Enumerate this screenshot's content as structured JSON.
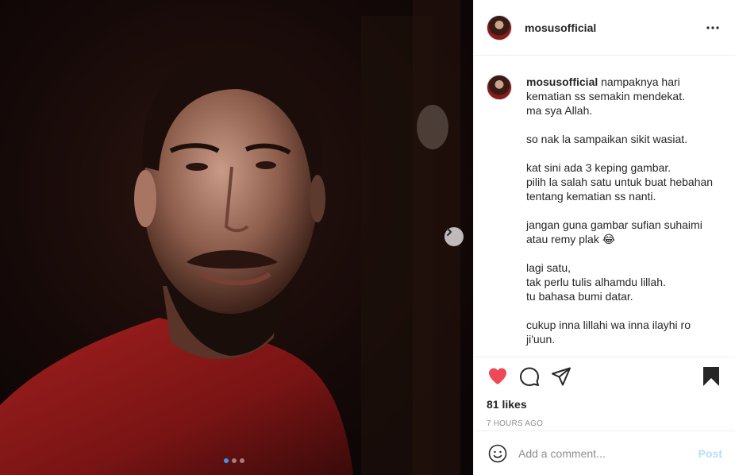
{
  "post": {
    "username": "mosusofficial",
    "caption_lines": [
      "nampaknya hari",
      "kematian ss semakin mendekat.",
      "ma sya Allah.",
      "",
      "so nak la sampaikan sikit wasiat.",
      "",
      "kat sini ada 3 keping gambar.",
      "pilih la salah satu untuk buat hebahan",
      "tentang kematian ss nanti.",
      "",
      "jangan guna gambar sufian suhaimi",
      "atau remy plak 😂",
      "",
      "lagi satu,",
      "tak perlu tulis alhamdu lillah.",
      "tu bahasa bumi datar.",
      "",
      "cukup inna lillahi wa inna ilayhi ro",
      "ji'uun."
    ],
    "likes": "81 likes",
    "time": "7 HOURS AGO"
  },
  "icons": {
    "more": "more-options-icon",
    "like": "heart-icon",
    "comment": "comment-icon",
    "share": "share-icon",
    "save": "bookmark-icon",
    "next": "chevron-right-icon",
    "emoji": "emoji-icon"
  },
  "carousel": {
    "slides": 3,
    "current": 1
  },
  "comment_box": {
    "placeholder": "Add a comment...",
    "post_label": "Post"
  },
  "colors": {
    "heart": "#ed4956",
    "carousel_active_dot": "#3897f0",
    "post_button": "#b2dffc",
    "shirt": "#8e1a1a"
  }
}
